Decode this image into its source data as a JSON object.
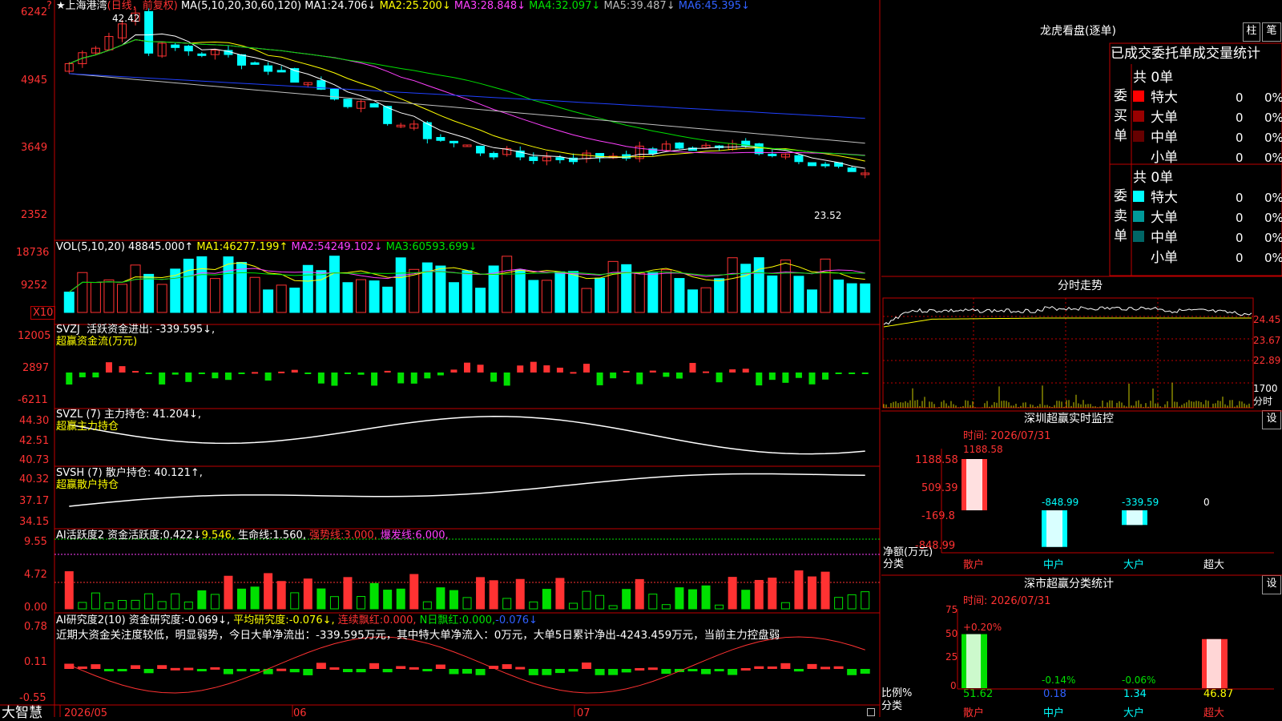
{
  "app": {
    "brand": "大智慧"
  },
  "colors": {
    "up": "#ff3232",
    "down": "#00ffff",
    "ma1": "#ffffff",
    "ma2": "#ffff00",
    "ma3": "#ff40ff",
    "ma4": "#00e000",
    "ma5": "#c0c0c0",
    "ma6": "#2040ff",
    "frame": "#c00000"
  },
  "price": {
    "title": "★上海港湾",
    "mode": "(日线，前复权)",
    "ma_label": "MA(5,10,20,30,60,120)",
    "ma": [
      {
        "name": "MA1:",
        "value": "24.706↓"
      },
      {
        "name": "MA2:",
        "value": "25.200↓"
      },
      {
        "name": "MA3:",
        "value": "28.848↓"
      },
      {
        "name": "MA4:",
        "value": "32.097↓"
      },
      {
        "name": "MA5:",
        "value": "39.487↓"
      },
      {
        "name": "MA6:",
        "value": "45.395↓"
      }
    ],
    "yticks": [
      "6242",
      "4945",
      "3649",
      "2352"
    ],
    "high_label": "42.42",
    "low_label": "23.52",
    "high_marker": "?"
  },
  "volume": {
    "label": "VOL(5,10,20)",
    "value": "48845.000↑",
    "ma": [
      {
        "name": "MA1:",
        "value": "46277.199↑"
      },
      {
        "name": "MA2:",
        "value": "54249.102↓"
      },
      {
        "name": "MA3:",
        "value": "60593.699↓"
      }
    ],
    "yticks": [
      "18736",
      "9252"
    ],
    "unit": "X10"
  },
  "svzj": {
    "label": "SVZJ",
    "name": "活跃资金进出:",
    "value": "-339.595↓,",
    "sub": "超赢资金流(万元)",
    "yticks": [
      "12005",
      "2897",
      "-6211"
    ]
  },
  "svzl": {
    "label": "SVZL (7)",
    "name": "主力持仓:",
    "value": "41.204↓,",
    "sub": "超赢主力持仓",
    "yticks": [
      "44.30",
      "42.51",
      "40.73"
    ]
  },
  "svsh": {
    "label": "SVSH (7)",
    "name": "散户持仓:",
    "value": "40.121↑,",
    "sub": "超赢散户持仓",
    "yticks": [
      "40.32",
      "37.17",
      "34.15"
    ]
  },
  "ai1": {
    "label": "AI活跃度2",
    "items": [
      {
        "name": "资金活跃度:",
        "value": "0.422↓",
        "cls": "wht"
      },
      {
        "name": "",
        "value": "9.546,",
        "cls": "yel"
      },
      {
        "name": "生命线:",
        "value": "1.560,",
        "cls": "wht"
      },
      {
        "name": "强势线:",
        "value": "3.000,",
        "cls": "red"
      },
      {
        "name": "爆发线:",
        "value": "6.000,",
        "cls": "mag"
      }
    ],
    "yticks": [
      "9.55",
      "4.72",
      "0.00"
    ]
  },
  "ai2": {
    "label": "AI研究度2(10)",
    "items": [
      {
        "name": "资金研究度:",
        "value": "-0.069↓,",
        "cls": "wht"
      },
      {
        "name": "平均研究度:",
        "value": "-0.076↓,",
        "cls": "yel"
      },
      {
        "name": "连续飘红:",
        "value": "0.000,",
        "cls": "red"
      },
      {
        "name": "N日飘红:",
        "value": "0.000,",
        "cls": "grn"
      },
      {
        "name": "",
        "value": "-0.076↓",
        "cls": "blu"
      }
    ],
    "summary": "近期大资金关注度较低，明显弱势，今日大单净流出：-339.595万元，其中特大单净流入：0万元，大单5日累计净出-4243.459万元，当前主力控盘弱",
    "yticks": [
      "0.78",
      "0.11",
      "-0.55"
    ]
  },
  "xaxis": {
    "labels": [
      "2026/05",
      "06",
      "07"
    ]
  },
  "lhb": {
    "title": "龙虎看盘(逐单)",
    "btn1": "柱",
    "btn2": "笔",
    "header": "已成交委托单成交量统计",
    "buy": {
      "label": "委买单",
      "total": "共 0单",
      "rows": [
        {
          "name": "特大",
          "count": "0",
          "pct": "0%",
          "color": "#ff0000"
        },
        {
          "name": "大单",
          "count": "0",
          "pct": "0%",
          "color": "#990000"
        },
        {
          "name": "中单",
          "count": "0",
          "pct": "0%",
          "color": "#660000"
        },
        {
          "name": "小单",
          "count": "0",
          "pct": "0%",
          "color": ""
        }
      ]
    },
    "sell": {
      "label": "委卖单",
      "total": "共 0单",
      "rows": [
        {
          "name": "特大",
          "count": "0",
          "pct": "0%",
          "color": "#00ffff"
        },
        {
          "name": "大单",
          "count": "0",
          "pct": "0%",
          "color": "#009999"
        },
        {
          "name": "中单",
          "count": "0",
          "pct": "0%",
          "color": "#006666"
        },
        {
          "name": "小单",
          "count": "0",
          "pct": "0%",
          "color": ""
        }
      ]
    }
  },
  "intraday": {
    "title": "分时走势",
    "yticks": [
      "24.45",
      "23.67",
      "22.89"
    ],
    "vol_label": "1700",
    "vol_unit": "分时"
  },
  "sz_monitor": {
    "title": "深圳超赢实时监控",
    "btn": "设",
    "time": "时间: 2026/07/31",
    "yticks": [
      "1188.58",
      "509.39",
      "-169.8",
      "-848.99"
    ],
    "ylabel": "净额(万元)",
    "cat_label": "分类",
    "bars": [
      {
        "name": "散户",
        "value": "1188.58",
        "num": 1188.58
      },
      {
        "name": "中户",
        "value": "-848.99",
        "num": -848.99
      },
      {
        "name": "大户",
        "value": "-339.59",
        "num": -339.59
      },
      {
        "name": "超大",
        "value": "0",
        "num": 0
      }
    ]
  },
  "sz_class": {
    "title": "深市超赢分类统计",
    "btn": "设",
    "time": "时间: 2026/07/31",
    "yticks": [
      "75",
      "50",
      "25",
      "0"
    ],
    "ylabel": "比例%",
    "cat_label": "分类",
    "bars": [
      {
        "name": "散户",
        "value": "51.62",
        "delta": "+0.20%",
        "num": 51.62
      },
      {
        "name": "中户",
        "value": "0.18",
        "delta": "-0.14%",
        "num": 0.18
      },
      {
        "name": "大户",
        "value": "1.34",
        "delta": "-0.06%",
        "num": 1.34
      },
      {
        "name": "超大",
        "value": "46.87",
        "delta": "",
        "num": 46.87
      }
    ]
  }
}
